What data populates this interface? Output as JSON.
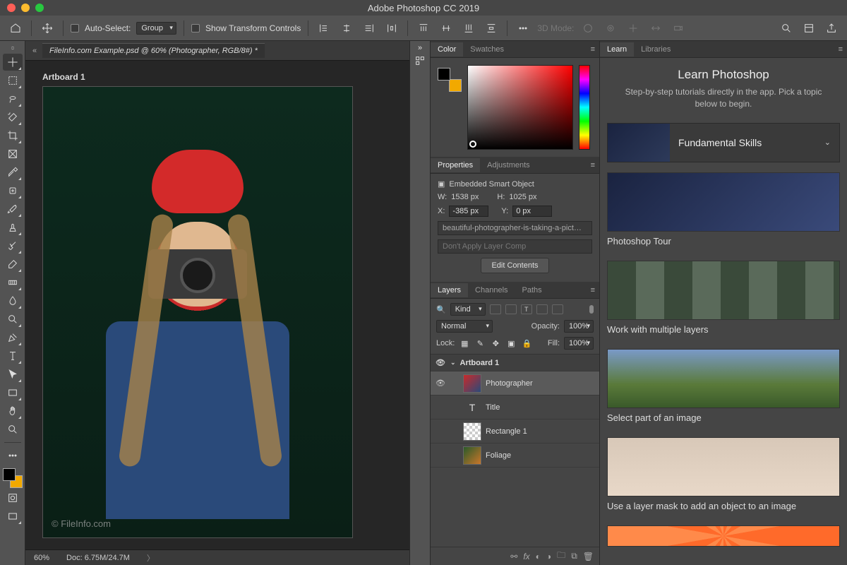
{
  "window": {
    "title": "Adobe Photoshop CC 2019"
  },
  "optbar": {
    "autoselect_label": "Auto-Select:",
    "autoselect_mode": "Group",
    "transform_label": "Show Transform Controls",
    "mode3d_label": "3D Mode:"
  },
  "document": {
    "tab_title": "FileInfo.com Example.psd @ 60% (Photographer, RGB/8#) *",
    "artboard_label": "Artboard 1",
    "watermark": "© FileInfo.com",
    "zoom": "60%",
    "docsize": "Doc: 6.75M/24.7M"
  },
  "panels": {
    "color_tab": "Color",
    "swatches_tab": "Swatches",
    "properties_tab": "Properties",
    "adjustments_tab": "Adjustments",
    "layers_tab": "Layers",
    "channels_tab": "Channels",
    "paths_tab": "Paths"
  },
  "properties": {
    "type_label": "Embedded Smart Object",
    "w_label": "W:",
    "w_value": "1538 px",
    "h_label": "H:",
    "h_value": "1025 px",
    "x_label": "X:",
    "x_value": "-385 px",
    "y_label": "Y:",
    "y_value": "0 px",
    "filename": "beautiful-photographer-is-taking-a-pict…",
    "layercomp": "Don't Apply Layer Comp",
    "edit_btn": "Edit Contents"
  },
  "layers": {
    "filter_label": "Kind",
    "blend_mode": "Normal",
    "opacity_label": "Opacity:",
    "opacity_value": "100%",
    "lock_label": "Lock:",
    "fill_label": "Fill:",
    "fill_value": "100%",
    "items": [
      {
        "name": "Artboard 1",
        "artboard": true
      },
      {
        "name": "Photographer",
        "selected": true
      },
      {
        "name": "Title",
        "type": "text"
      },
      {
        "name": "Rectangle 1",
        "type": "shape"
      },
      {
        "name": "Foliage",
        "type": "smart"
      }
    ]
  },
  "learn": {
    "tab_learn": "Learn",
    "tab_libraries": "Libraries",
    "heading": "Learn Photoshop",
    "sub": "Step-by-step tutorials directly in the app. Pick a topic below to begin.",
    "accordion": "Fundamental Skills",
    "cards": [
      {
        "title": "Photoshop Tour"
      },
      {
        "title": "Work with multiple layers"
      },
      {
        "title": "Select part of an image"
      },
      {
        "title": "Use a layer mask to add an object to an image"
      }
    ]
  }
}
